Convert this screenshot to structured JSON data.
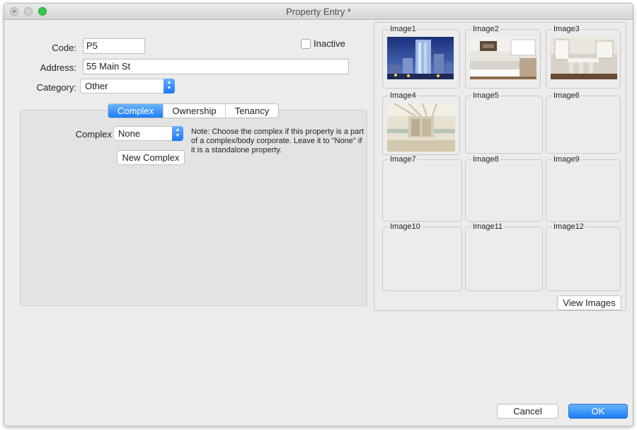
{
  "window": {
    "title": "Property Entry *"
  },
  "form": {
    "code_label": "Code:",
    "code_value": "P5",
    "inactive_label": "Inactive",
    "address_label": "Address:",
    "address_value": "55 Main St",
    "category_label": "Category:",
    "category_value": "Other"
  },
  "tabs": {
    "items": [
      {
        "label": "Complex",
        "active": true
      },
      {
        "label": "Ownership",
        "active": false
      },
      {
        "label": "Tenancy",
        "active": false
      }
    ]
  },
  "complex": {
    "label": "Complex",
    "value": "None",
    "new_button": "New Complex",
    "note": "Note: Choose the complex if this property is a part of a complex/body corporate. Leave it to \"None\" if it is a standalone property."
  },
  "images": {
    "cells": [
      {
        "label": "Image1",
        "icon": "building-photo"
      },
      {
        "label": "Image2",
        "icon": "kitchen-photo"
      },
      {
        "label": "Image3",
        "icon": "dining-room-photo"
      },
      {
        "label": "Image4",
        "icon": "atrium-photo"
      },
      {
        "label": "Image5"
      },
      {
        "label": "Image6"
      },
      {
        "label": "Image7"
      },
      {
        "label": "Image8"
      },
      {
        "label": "Image9"
      },
      {
        "label": "Image10"
      },
      {
        "label": "Image11"
      },
      {
        "label": "Image12"
      }
    ],
    "view_button": "View Images"
  },
  "footer": {
    "cancel": "Cancel",
    "ok": "OK"
  },
  "colors": {
    "accent": "#1a7ef5",
    "window_bg": "#ececec",
    "panel_bg": "#e3e3e3"
  }
}
